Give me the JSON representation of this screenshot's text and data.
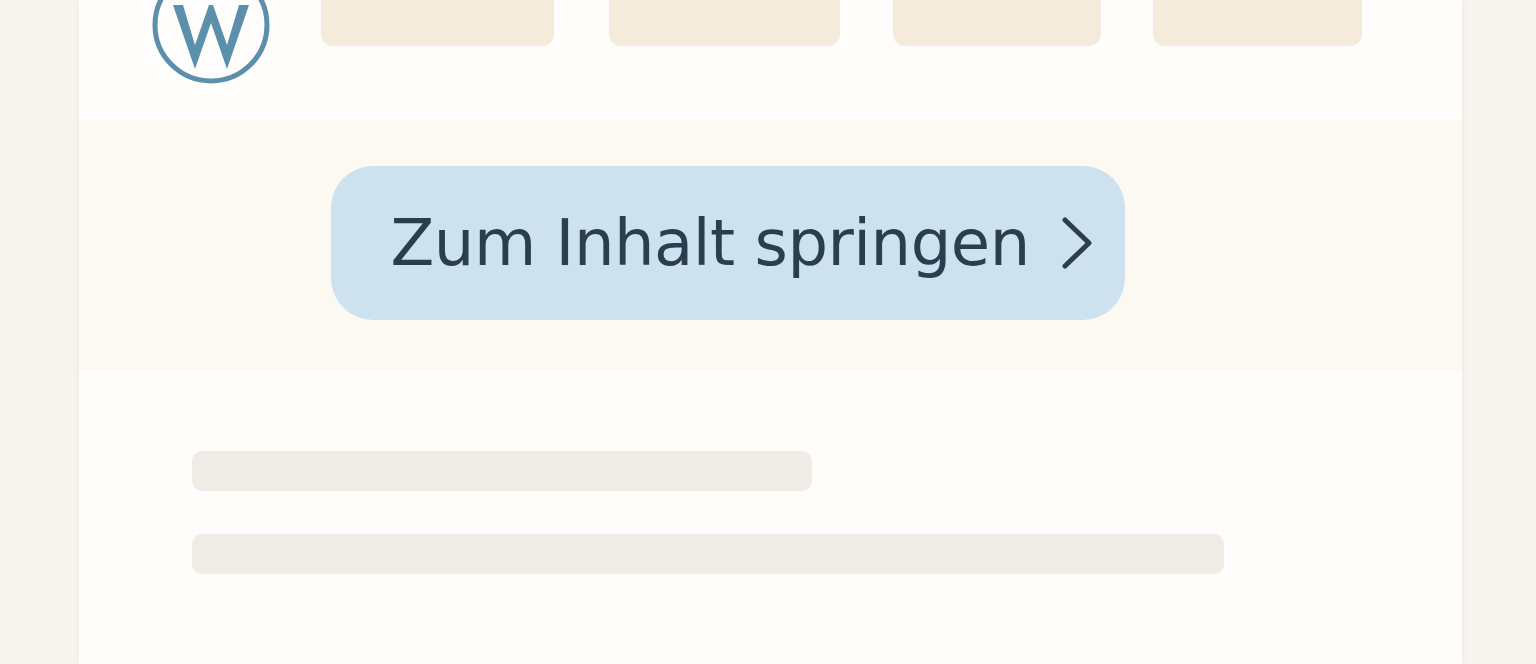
{
  "skip_link": {
    "label": "Zum Inhalt springen"
  }
}
